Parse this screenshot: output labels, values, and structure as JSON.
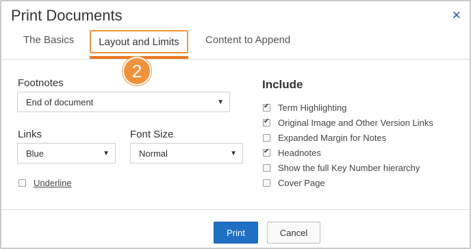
{
  "dialog": {
    "title": "Print Documents",
    "close_glyph": "✕"
  },
  "tabs": [
    {
      "label": "The Basics",
      "active": false
    },
    {
      "label": "Layout and Limits",
      "active": true
    },
    {
      "label": "Content to Append",
      "active": false
    }
  ],
  "step_badge": "2",
  "left": {
    "footnotes": {
      "label": "Footnotes",
      "value": "End of document"
    },
    "links": {
      "label": "Links",
      "value": "Blue"
    },
    "font_size": {
      "label": "Font Size",
      "value": "Normal"
    },
    "underline": {
      "label": "Underline",
      "checked": false
    }
  },
  "include": {
    "heading": "Include",
    "items": [
      {
        "label": "Term Highlighting",
        "checked": true
      },
      {
        "label": "Original Image and Other Version Links",
        "checked": true
      },
      {
        "label": "Expanded Margin for Notes",
        "checked": false
      },
      {
        "label": "Headnotes",
        "checked": true
      },
      {
        "label": "Show the full Key Number hierarchy",
        "checked": false
      },
      {
        "label": "Cover Page",
        "checked": false
      }
    ]
  },
  "footer": {
    "print_label": "Print",
    "cancel_label": "Cancel"
  },
  "colors": {
    "accent_orange": "#e87722",
    "primary_blue": "#1f6fc5"
  },
  "icons": {
    "close": "close-icon",
    "dropdown": "chevron-down-icon",
    "checked": "checkmark-icon"
  }
}
